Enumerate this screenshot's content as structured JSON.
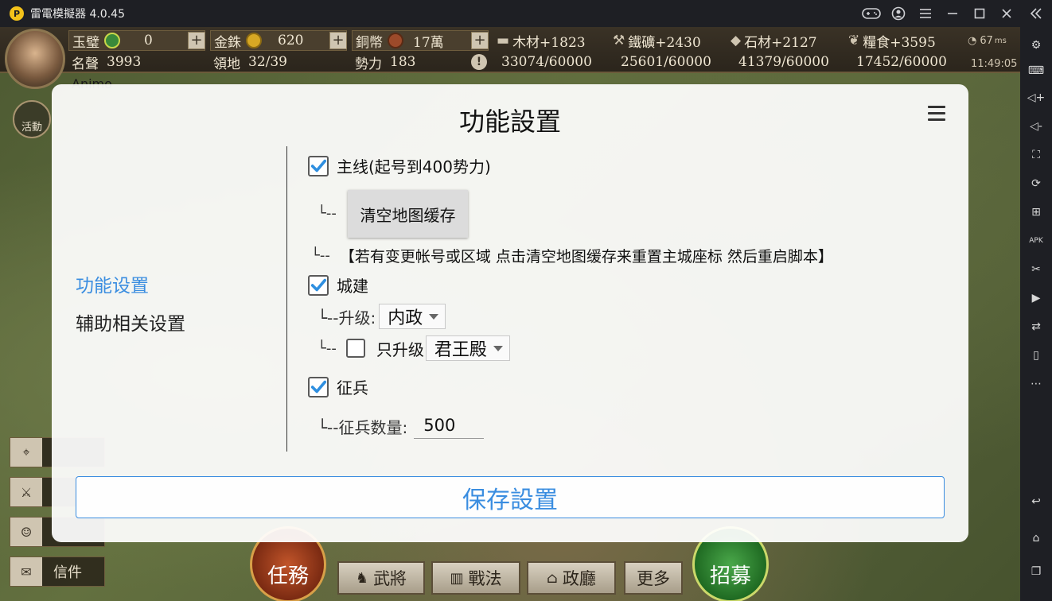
{
  "window": {
    "title": "雷電模擬器 4.0.45",
    "logo_glyph": "P",
    "controls": [
      "gamepad-icon",
      "account-icon",
      "menu-icon",
      "minimize-icon",
      "maximize-icon",
      "close-icon",
      "collapse-icon"
    ]
  },
  "hud": {
    "jade": {
      "label": "玉璧",
      "value": "0"
    },
    "gold": {
      "label": "金銖",
      "value": "620"
    },
    "copper": {
      "label": "銅幣",
      "value": "17萬"
    },
    "fame": {
      "label": "名聲",
      "value": "3993"
    },
    "territory": {
      "label": "領地",
      "value": "32/39"
    },
    "power": {
      "label": "勢力",
      "value": "183"
    },
    "wood": {
      "label": "木材+1823",
      "value": "33074/60000"
    },
    "iron": {
      "label": "鐵礦+2430",
      "value": "25601/60000"
    },
    "stone": {
      "label": "石材+2127",
      "value": "41379/60000"
    },
    "grain": {
      "label": "糧食+3595",
      "value": "17452/60000"
    },
    "ping": "67",
    "ping_unit": "ms",
    "clock": "11:49:05",
    "player_name": "Animo",
    "activity_label": "活動"
  },
  "game_bottom": {
    "mission": "任務",
    "generals": "武將",
    "tactics": "戰法",
    "government": "政廳",
    "more": "更多",
    "recruit": "招募",
    "mail": "信件"
  },
  "dialog": {
    "title": "功能設置",
    "nav": [
      {
        "label": "功能设置",
        "active": true
      },
      {
        "label": "辅助相关设置",
        "active": false
      }
    ],
    "main_line": {
      "label": "主线(起号到400势力)",
      "checked": true
    },
    "tree_prefix_1": "└--",
    "clear_cache_button": "清空地图缓存",
    "note_prefix": "└--",
    "note": "【若有变更帐号或区域  点击清空地图缓存来重置主城座标 然后重启脚本】",
    "build": {
      "label": "城建",
      "checked": true
    },
    "upgrade_prefix": "└--升级:",
    "upgrade_value": "内政",
    "only_prefix": "└--",
    "only_checked": false,
    "only_label": "只升级",
    "only_value": "君王殿",
    "conscript": {
      "label": "征兵",
      "checked": true
    },
    "conscript_prefix": "└--征兵数量:",
    "conscript_value": "500",
    "save_button": "保存設置"
  }
}
